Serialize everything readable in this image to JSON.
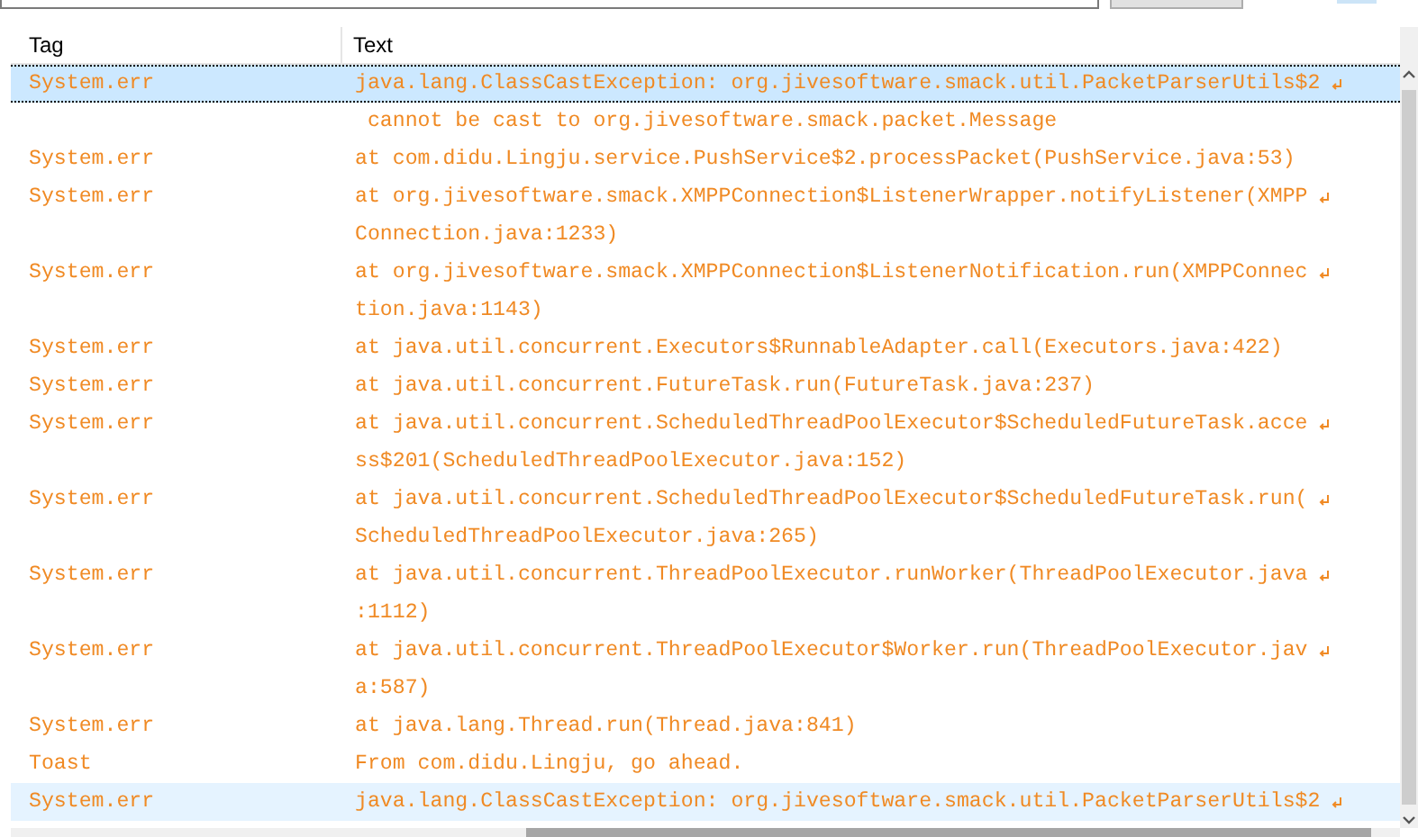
{
  "columns": [
    "Tag",
    "Text"
  ],
  "rows": [
    {
      "tag": "System.err",
      "selected": true,
      "hovered": false,
      "lines": [
        {
          "text": "java.lang.ClassCastException: org.jivesoftware.smack.util.PacketParserUtils$2",
          "wrapped": true
        },
        {
          "text": " cannot be cast to org.jivesoftware.smack.packet.Message",
          "wrapped": false
        }
      ]
    },
    {
      "tag": "System.err",
      "selected": false,
      "hovered": false,
      "lines": [
        {
          "text": "at com.didu.Lingju.service.PushService$2.processPacket(PushService.java:53)",
          "wrapped": false
        }
      ]
    },
    {
      "tag": "System.err",
      "selected": false,
      "hovered": false,
      "lines": [
        {
          "text": "at org.jivesoftware.smack.XMPPConnection$ListenerWrapper.notifyListener(XMPP",
          "wrapped": true
        },
        {
          "text": "Connection.java:1233)",
          "wrapped": false
        }
      ]
    },
    {
      "tag": "System.err",
      "selected": false,
      "hovered": false,
      "lines": [
        {
          "text": "at org.jivesoftware.smack.XMPPConnection$ListenerNotification.run(XMPPConnec",
          "wrapped": true
        },
        {
          "text": "tion.java:1143)",
          "wrapped": false
        }
      ]
    },
    {
      "tag": "System.err",
      "selected": false,
      "hovered": false,
      "lines": [
        {
          "text": "at java.util.concurrent.Executors$RunnableAdapter.call(Executors.java:422)",
          "wrapped": false
        }
      ]
    },
    {
      "tag": "System.err",
      "selected": false,
      "hovered": false,
      "lines": [
        {
          "text": "at java.util.concurrent.FutureTask.run(FutureTask.java:237)",
          "wrapped": false
        }
      ]
    },
    {
      "tag": "System.err",
      "selected": false,
      "hovered": false,
      "lines": [
        {
          "text": "at java.util.concurrent.ScheduledThreadPoolExecutor$ScheduledFutureTask.acce",
          "wrapped": true
        },
        {
          "text": "ss$201(ScheduledThreadPoolExecutor.java:152)",
          "wrapped": false
        }
      ]
    },
    {
      "tag": "System.err",
      "selected": false,
      "hovered": false,
      "lines": [
        {
          "text": "at java.util.concurrent.ScheduledThreadPoolExecutor$ScheduledFutureTask.run(",
          "wrapped": true
        },
        {
          "text": "ScheduledThreadPoolExecutor.java:265)",
          "wrapped": false
        }
      ]
    },
    {
      "tag": "System.err",
      "selected": false,
      "hovered": false,
      "lines": [
        {
          "text": "at java.util.concurrent.ThreadPoolExecutor.runWorker(ThreadPoolExecutor.java",
          "wrapped": true
        },
        {
          "text": ":1112)",
          "wrapped": false
        }
      ]
    },
    {
      "tag": "System.err",
      "selected": false,
      "hovered": false,
      "lines": [
        {
          "text": "at java.util.concurrent.ThreadPoolExecutor$Worker.run(ThreadPoolExecutor.jav",
          "wrapped": true
        },
        {
          "text": "a:587)",
          "wrapped": false
        }
      ]
    },
    {
      "tag": "System.err",
      "selected": false,
      "hovered": false,
      "lines": [
        {
          "text": "at java.lang.Thread.run(Thread.java:841)",
          "wrapped": false
        }
      ]
    },
    {
      "tag": "Toast",
      "selected": false,
      "hovered": false,
      "lines": [
        {
          "text": "From com.didu.Lingju, go ahead.",
          "wrapped": false
        }
      ]
    },
    {
      "tag": "System.err",
      "selected": false,
      "hovered": true,
      "lines": [
        {
          "text": "java.lang.ClassCastException: org.jivesoftware.smack.util.PacketParserUtils$2",
          "wrapped": true
        }
      ]
    }
  ]
}
